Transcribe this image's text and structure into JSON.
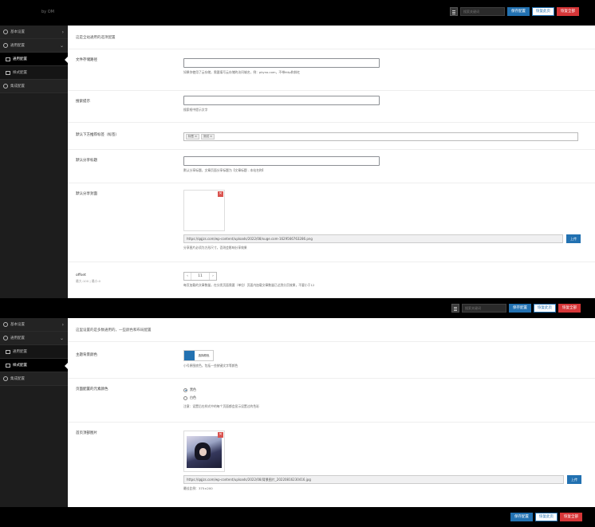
{
  "brand": "by OM",
  "toolbar": {
    "search_placeholder": "搜索关键词",
    "save_label": "保存配置",
    "restore_label": "恢复此页",
    "reset_label": "恢复全部"
  },
  "panel1": {
    "sidebar": {
      "items": [
        {
          "label": "基本设置",
          "arrow": "›"
        },
        {
          "label": "通用配置",
          "arrow": "⌄"
        },
        {
          "label": "通用配置",
          "active": true
        },
        {
          "label": "样式配置"
        },
        {
          "label": "集成配置"
        }
      ]
    },
    "note": "这是全站通用的选项配置",
    "fields": {
      "asset_dir": {
        "label": "文件存储路径",
        "help": "如果你使用了云存储，需要填写云存储的访问域名，例：pkyno.com，不带http和斜杠"
      },
      "search_hint": {
        "label": "搜索提示",
        "help": "搜索框中提示文字"
      },
      "tags": {
        "label": "默认下方推荐标签（标签）",
        "items": [
          "标签",
          "测试"
        ]
      },
      "share_title": {
        "label": "默认分享标题",
        "help": "默认分享标题，文章页面分享标题为【文章标题 - 本站名称】"
      },
      "share_image": {
        "label": "默认分享封面",
        "url": "https://qqjzs.com/wp-content/uploads/2022/08/xuge.com-1629566763286.png",
        "upload_label": "上传",
        "help": "分享图片必须为方形尺寸，否则会影响分享效果"
      },
      "offset": {
        "label": "offset",
        "sub": "最大:100 | 最小:0",
        "value": "11",
        "minus": "‹",
        "plus": "›",
        "help": "每页加载的文章数量，在分类页面需要（单位）页面内加载文章数量已达到分页效果，不要小于12"
      }
    }
  },
  "panel2": {
    "sidebar": {
      "items": [
        {
          "label": "基本设置",
          "arrow": "›"
        },
        {
          "label": "通用配置",
          "arrow": "⌄"
        },
        {
          "label": "通用配置"
        },
        {
          "label": "样式配置",
          "active": true
        },
        {
          "label": "集成配置"
        }
      ]
    },
    "note": "这里设置的是多数通用的，一些颜色和布局配置",
    "fields": {
      "theme_color": {
        "label": "主题背景颜色",
        "button_label": "选择颜色",
        "help": "小号原图底色，包括一些按键文字等颜色"
      },
      "mode": {
        "label": "页面配置的元素颜色",
        "options": [
          "黑色",
          "白色"
        ],
        "help": "注意：设置后在样式中的每个页面都会显示设置过的色彩"
      },
      "home_image": {
        "label": "首页顶部图片",
        "url": "https://qqjzs.com/wp-content/uploads/2022/08/背景图片_20220816230416.jpg",
        "upload_label": "上传",
        "help": "最佳比例：375×200"
      }
    }
  },
  "colors": {
    "accent": "#2271b1",
    "danger": "#d63638",
    "sidebar": "#1d1d1d"
  }
}
